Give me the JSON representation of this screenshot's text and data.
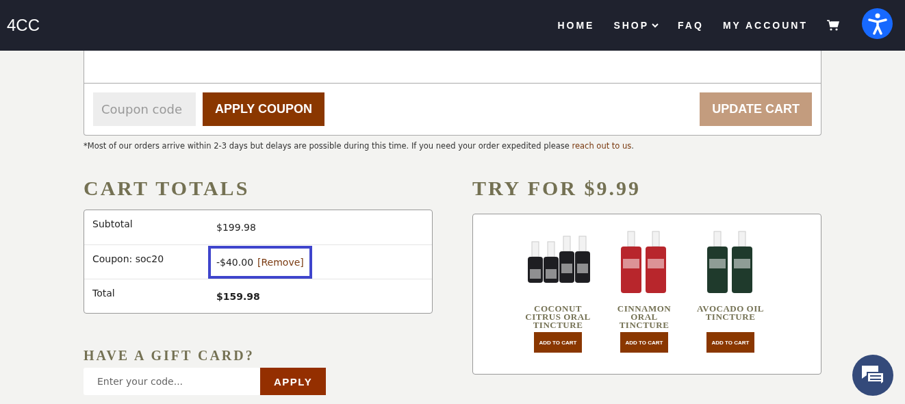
{
  "header": {
    "logo": "4CC",
    "nav": [
      {
        "label": "HOME",
        "dropdown": false
      },
      {
        "label": "SHOP",
        "dropdown": true
      },
      {
        "label": "FAQ",
        "dropdown": false
      },
      {
        "label": "MY ACCOUNT",
        "dropdown": false
      }
    ]
  },
  "cart_actions": {
    "coupon": {
      "placeholder": "Coupon code"
    },
    "apply_button": "APPLY COUPON",
    "update_button": "UPDATE CART",
    "update_disabled": true
  },
  "note": {
    "text": "*Most of our orders arrive within 2-3 days but delays are possible during this time. If you need your order expedited please ",
    "link": "reach out to us",
    "end": "."
  },
  "cart_totals": {
    "title": "CART TOTALS",
    "rows": [
      {
        "label": "Subtotal",
        "value": "$199.98",
        "bold": false,
        "highlighted": false
      },
      {
        "label": "Coupon: soc20",
        "value": "-$40.00",
        "link": "[Remove]",
        "bold": false,
        "highlighted": true
      },
      {
        "label": "Total",
        "value": "$159.98",
        "bold": true,
        "highlighted": false
      }
    ]
  },
  "gift_card": {
    "title": "HAVE A GIFT CARD?",
    "placeholder": "Enter your code...",
    "button": "APPLY"
  },
  "offer": {
    "title": "TRY FOR $9.99",
    "products": [
      {
        "name": "COCONUT CITRUS ORAL TINCTURE",
        "button": "ADD TO CART"
      },
      {
        "name": "CINNAMON ORAL TINCTURE",
        "button": "ADD TO CART"
      },
      {
        "name": "AVOCADO OIL TINCTURE",
        "button": "ADD TO CART"
      }
    ]
  }
}
